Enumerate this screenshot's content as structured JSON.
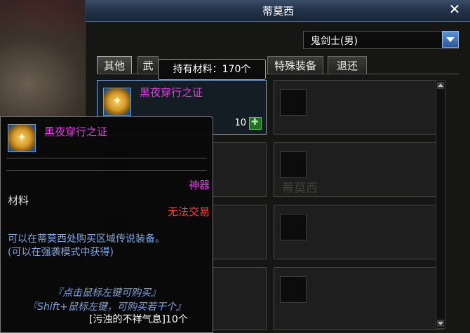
{
  "window": {
    "title": "蒂莫西"
  },
  "character_select": {
    "value": "鬼剑士(男)"
  },
  "tabs": [
    "其他",
    "武",
    "特殊装备",
    "退还"
  ],
  "tooltip_hover": {
    "text": "持有材料：170个"
  },
  "shop_item": {
    "name": "黑夜穿行之证",
    "quantity": "10"
  },
  "watermark": "蒂莫西",
  "item_tooltip": {
    "name": "黑夜穿行之证",
    "rarity": "神器",
    "type": "材料",
    "trade": "无法交易",
    "description": [
      "可以在蒂莫西处购买区域传说装备。",
      "(可以在强袭模式中获得)"
    ],
    "hints": [
      "『点击鼠标左键可购买』",
      "『Shift+鼠标左键，可购买若干个』"
    ],
    "cost": "[污浊的不祥气息]10个"
  }
}
